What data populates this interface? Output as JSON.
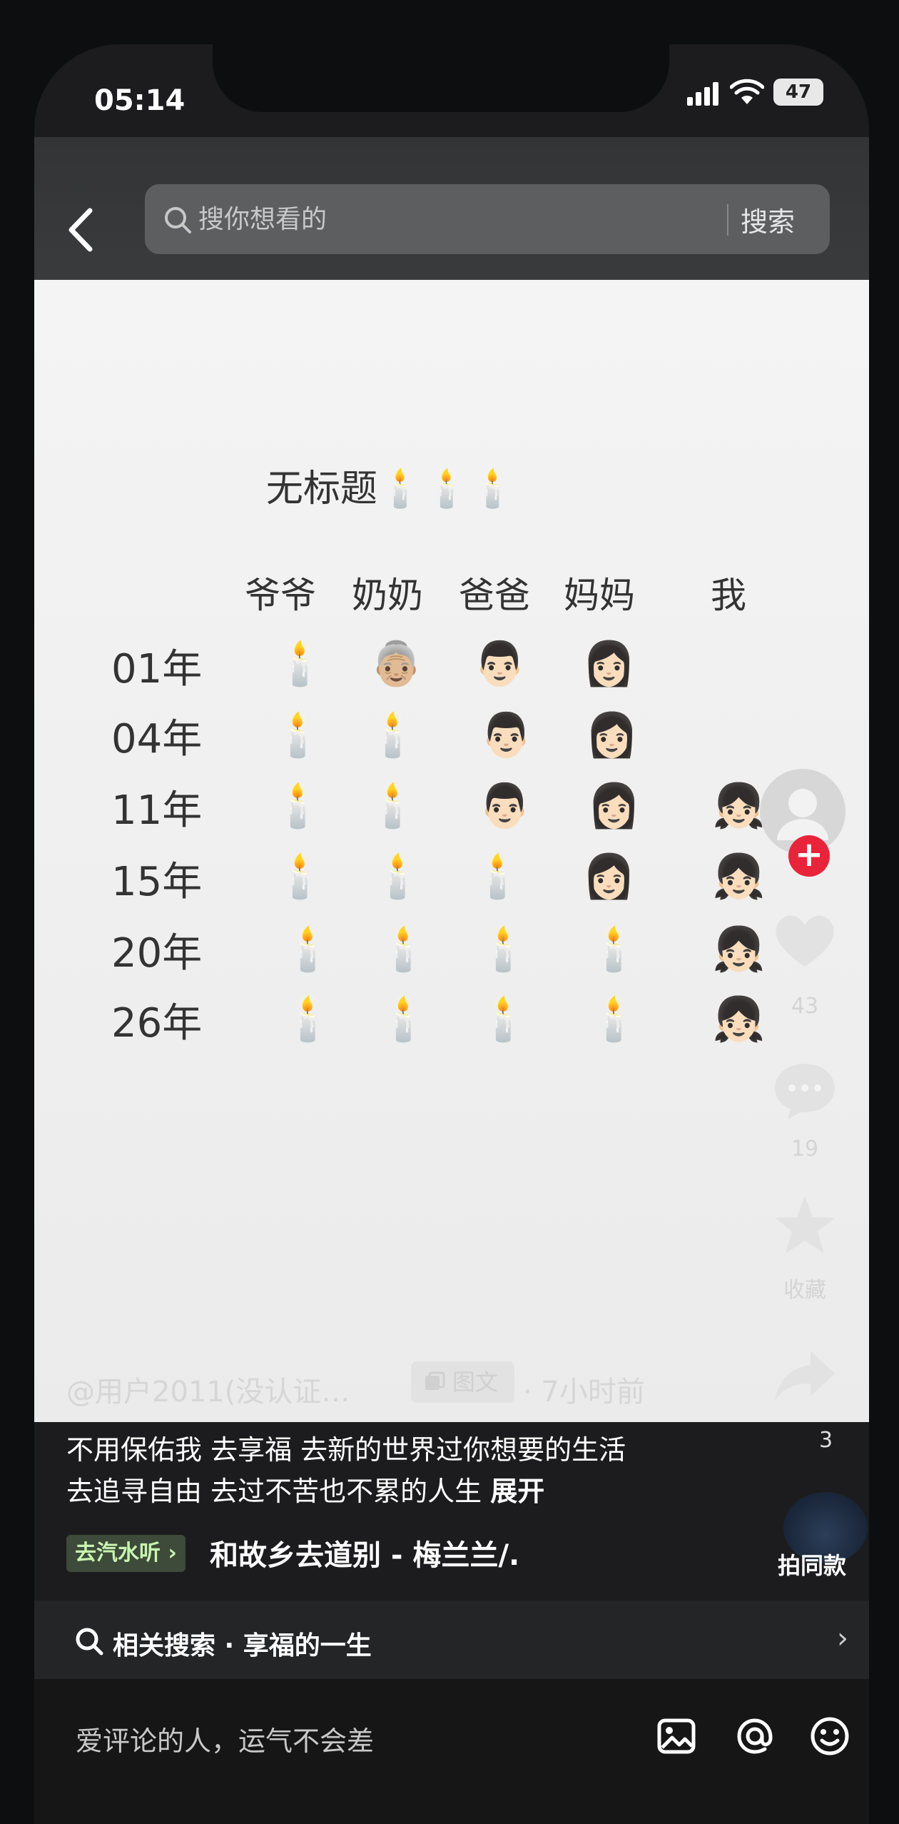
{
  "status": {
    "time": "05:14",
    "battery": "47"
  },
  "search": {
    "placeholder": "搜你想看的",
    "button": "搜索"
  },
  "post": {
    "title": "无标题🕯️🕯️🕯️",
    "columns": [
      "爷爷",
      "奶奶",
      "爸爸",
      "妈妈",
      "我"
    ],
    "rows": [
      {
        "label": "01年",
        "cells": [
          "🕯️",
          "👵🏼",
          "👨🏻",
          "👩🏻",
          ""
        ]
      },
      {
        "label": "04年",
        "cells": [
          "🕯️",
          "🕯️",
          "👨🏻",
          "👩🏻",
          ""
        ]
      },
      {
        "label": "11年",
        "cells": [
          "🕯️",
          "🕯️",
          "👨🏻",
          "👩🏻",
          "👧🏻"
        ]
      },
      {
        "label": "15年",
        "cells": [
          "🕯️",
          "🕯️",
          "🕯️",
          "👩🏻",
          "👧🏻"
        ]
      },
      {
        "label": "20年",
        "cells": [
          "🕯️",
          "🕯️",
          "🕯️",
          "🕯️",
          "👧🏻"
        ]
      },
      {
        "label": "26年",
        "cells": [
          "🕯️",
          "🕯️",
          "🕯️",
          "🕯️",
          "👧🏻"
        ]
      }
    ]
  },
  "sidebar": {
    "like_count": "43",
    "comment_count": "19",
    "favorite_label": "收藏",
    "share_count": "3",
    "same_style_label": "拍同款"
  },
  "meta": {
    "author": "@用户2011(没认证…",
    "type_badge": "图文",
    "time": "· 7小时前"
  },
  "caption": {
    "line1": "不用保佑我 去享福 去新的世界过你想要的生活",
    "line2": "去追寻自由 去过不苦也不累的人生",
    "expand": "展开"
  },
  "music": {
    "tag": "去汽水听 ›",
    "title": "和故乡去道别 - 梅兰兰/."
  },
  "related": {
    "label": "相关搜索 · 享福的一生"
  },
  "comment": {
    "placeholder": "爱评论的人，运气不会差"
  }
}
